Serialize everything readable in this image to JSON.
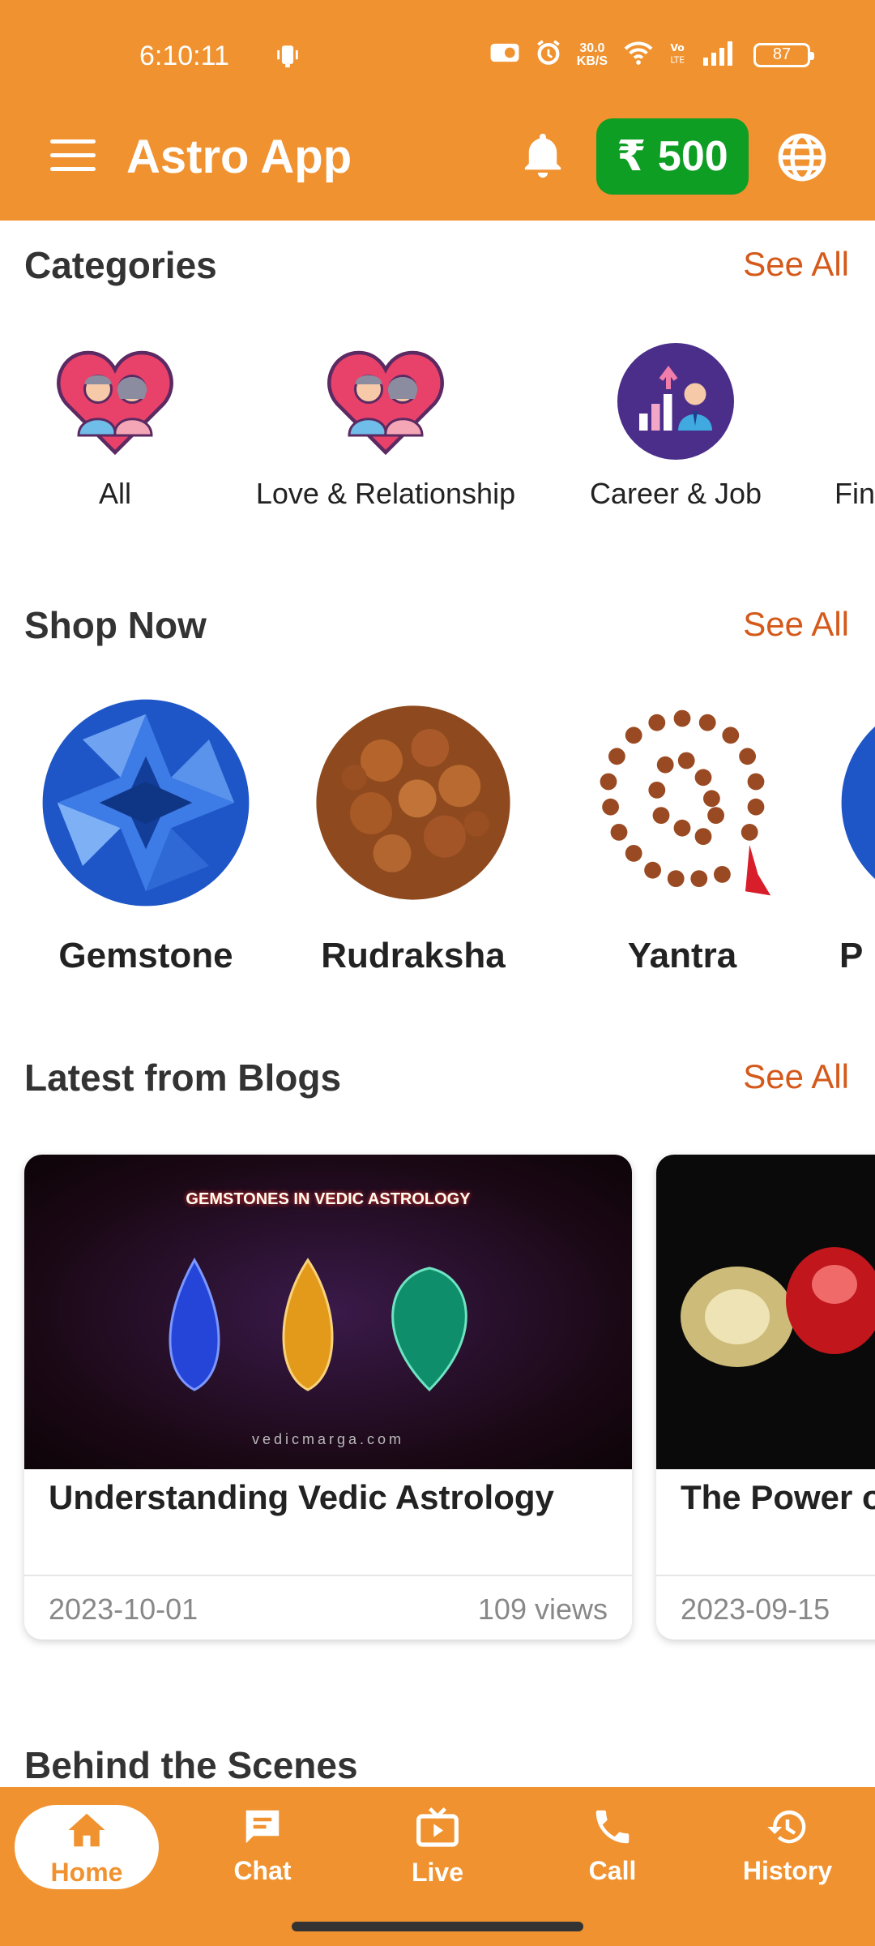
{
  "status": {
    "time": "6:10:11",
    "net_speed_value": "30.0",
    "net_speed_unit": "KB/S",
    "battery": "87"
  },
  "app_bar": {
    "title": "Astro App",
    "wallet_label": "₹ 500"
  },
  "categories": {
    "title": "Categories",
    "see_all": "See All",
    "items": [
      {
        "label": "All"
      },
      {
        "label": "Love & Relationship"
      },
      {
        "label": "Career & Job"
      },
      {
        "label": "Fin"
      }
    ]
  },
  "shop": {
    "title": "Shop Now",
    "see_all": "See All",
    "items": [
      {
        "label": "Gemstone"
      },
      {
        "label": "Rudraksha"
      },
      {
        "label": "Yantra"
      },
      {
        "label": "P"
      }
    ]
  },
  "blogs": {
    "title": "Latest from Blogs",
    "see_all": "See All",
    "items": [
      {
        "image_heading": "GEMSTONES IN VEDIC ASTROLOGY",
        "image_footer": "vedicmarga.com",
        "title": "Understanding Vedic Astrology",
        "date": "2023-10-01",
        "views": "109 views"
      },
      {
        "title": "The Power o Astrology",
        "date": "2023-09-15"
      }
    ]
  },
  "behind": {
    "title": "Behind the Scenes"
  },
  "bottom_nav": {
    "items": [
      {
        "label": "Home",
        "icon": "home-icon"
      },
      {
        "label": "Chat",
        "icon": "chat-icon"
      },
      {
        "label": "Live",
        "icon": "live-tv-icon"
      },
      {
        "label": "Call",
        "icon": "phone-icon"
      },
      {
        "label": "History",
        "icon": "history-icon"
      }
    ]
  },
  "colors": {
    "primary": "#F0922F",
    "wallet": "#0D9E23",
    "accent_link": "#D4591A"
  }
}
